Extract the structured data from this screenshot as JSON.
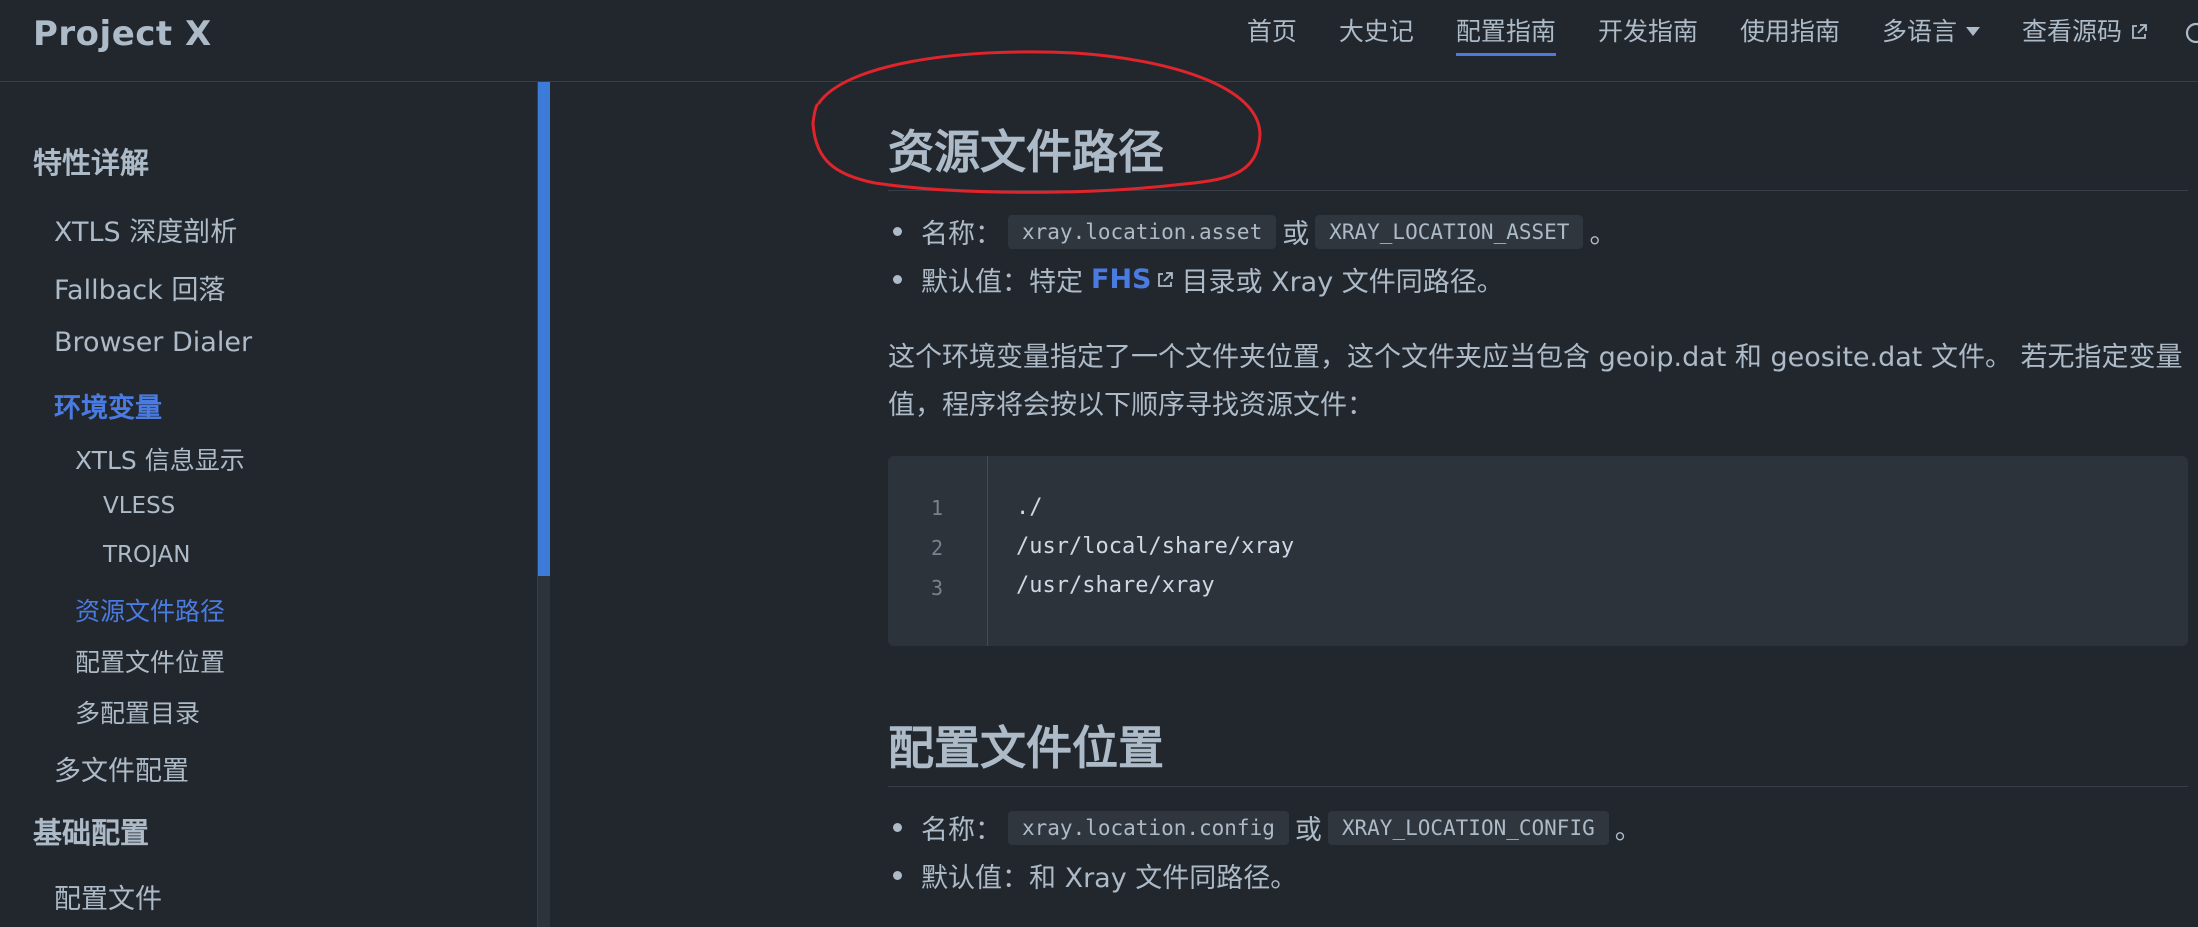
{
  "navbar": {
    "brand": "Project X",
    "links": [
      {
        "label": "首页"
      },
      {
        "label": "大史记"
      },
      {
        "label": "配置指南"
      },
      {
        "label": "开发指南"
      },
      {
        "label": "使用指南"
      },
      {
        "label": "多语言"
      },
      {
        "label": "查看源码"
      }
    ]
  },
  "sidebar": {
    "items": [
      {
        "label": "特性详解"
      },
      {
        "label": "XTLS 深度剖析"
      },
      {
        "label": "Fallback 回落"
      },
      {
        "label": "Browser Dialer"
      },
      {
        "label": "环境变量"
      },
      {
        "label": "XTLS 信息显示"
      },
      {
        "label": "VLESS"
      },
      {
        "label": "TROJAN"
      },
      {
        "label": "资源文件路径"
      },
      {
        "label": "配置文件位置"
      },
      {
        "label": "多配置目录"
      },
      {
        "label": "多文件配置"
      },
      {
        "label": "基础配置"
      },
      {
        "label": "配置文件"
      }
    ]
  },
  "content": {
    "section1": {
      "title": "资源文件路径",
      "name_label": "名称：",
      "name_code1": "xray.location.asset",
      "or_text": "或",
      "name_code2": "XRAY_LOCATION_ASSET",
      "name_end": "。",
      "default_label": "默认值：特定",
      "default_link": "FHS",
      "default_rest": "目录或 Xray 文件同路径。",
      "paragraph": "这个环境变量指定了一个文件夹位置，这个文件夹应当包含 geoip.dat 和 geosite.dat 文件。 若无指定变量值，程序将会按以下顺序寻找资源文件：",
      "code_lines": [
        {
          "no": "1",
          "text": "./"
        },
        {
          "no": "2",
          "text": "/usr/local/share/xray"
        },
        {
          "no": "3",
          "text": "/usr/share/xray"
        }
      ]
    },
    "section2": {
      "title": "配置文件位置",
      "name_label": "名称：",
      "name_code1": "xray.location.config",
      "or_text": "或",
      "name_code2": "XRAY_LOCATION_CONFIG",
      "name_end": "。",
      "default_text": "默认值：和 Xray 文件同路径。"
    }
  },
  "colors": {
    "background": "#22272e",
    "accent": "#4a7be0",
    "annotation": "#e0242b"
  }
}
